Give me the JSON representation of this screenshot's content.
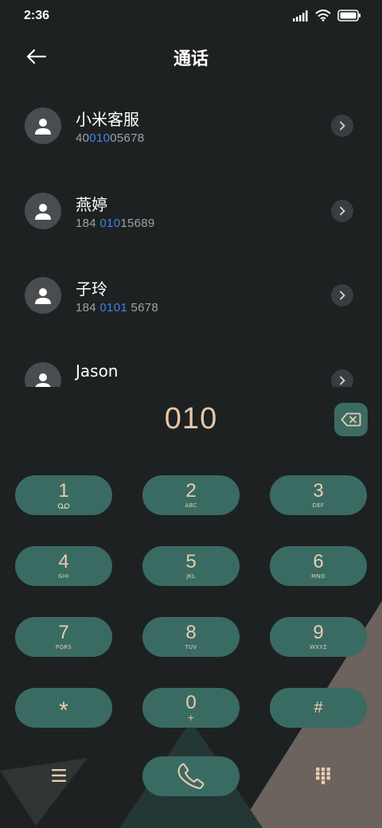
{
  "status": {
    "time": "2:36"
  },
  "header": {
    "title": "通话"
  },
  "contacts": [
    {
      "name": "小米客服",
      "number_pre": "40",
      "number_hl": "010",
      "number_post": "05678"
    },
    {
      "name": "燕婷",
      "number_pre": "184 ",
      "number_hl": "010",
      "number_post": "15689"
    },
    {
      "name": "子玲",
      "number_pre": "184 ",
      "number_hl": "0101",
      "number_post": " 5678"
    },
    {
      "name": "Jason",
      "number_pre": "",
      "number_hl": "",
      "number_post": ""
    }
  ],
  "dial": {
    "value": "010"
  },
  "keys": [
    {
      "digit": "1",
      "letters": ""
    },
    {
      "digit": "2",
      "letters": "ABC"
    },
    {
      "digit": "3",
      "letters": "DEF"
    },
    {
      "digit": "4",
      "letters": "GHI"
    },
    {
      "digit": "5",
      "letters": "JKL"
    },
    {
      "digit": "6",
      "letters": "MNO"
    },
    {
      "digit": "7",
      "letters": "PQRS"
    },
    {
      "digit": "8",
      "letters": "TUV"
    },
    {
      "digit": "9",
      "letters": "WXYZ"
    },
    {
      "digit": "*",
      "letters": ""
    },
    {
      "digit": "0",
      "letters": "+"
    },
    {
      "digit": "#",
      "letters": ""
    }
  ],
  "icons": {
    "back": "arrow-left-icon",
    "voicemail": "voicemail-icon",
    "backspace": "backspace-icon",
    "menu": "menu-icon",
    "call": "phone-icon",
    "dialpad": "dialpad-icon"
  },
  "colors": {
    "background": "#1e2121",
    "key": "#3a6b63",
    "key_text": "#e8cdb0",
    "highlight": "#3a86ea",
    "dialed_text": "#e5c6a8"
  }
}
